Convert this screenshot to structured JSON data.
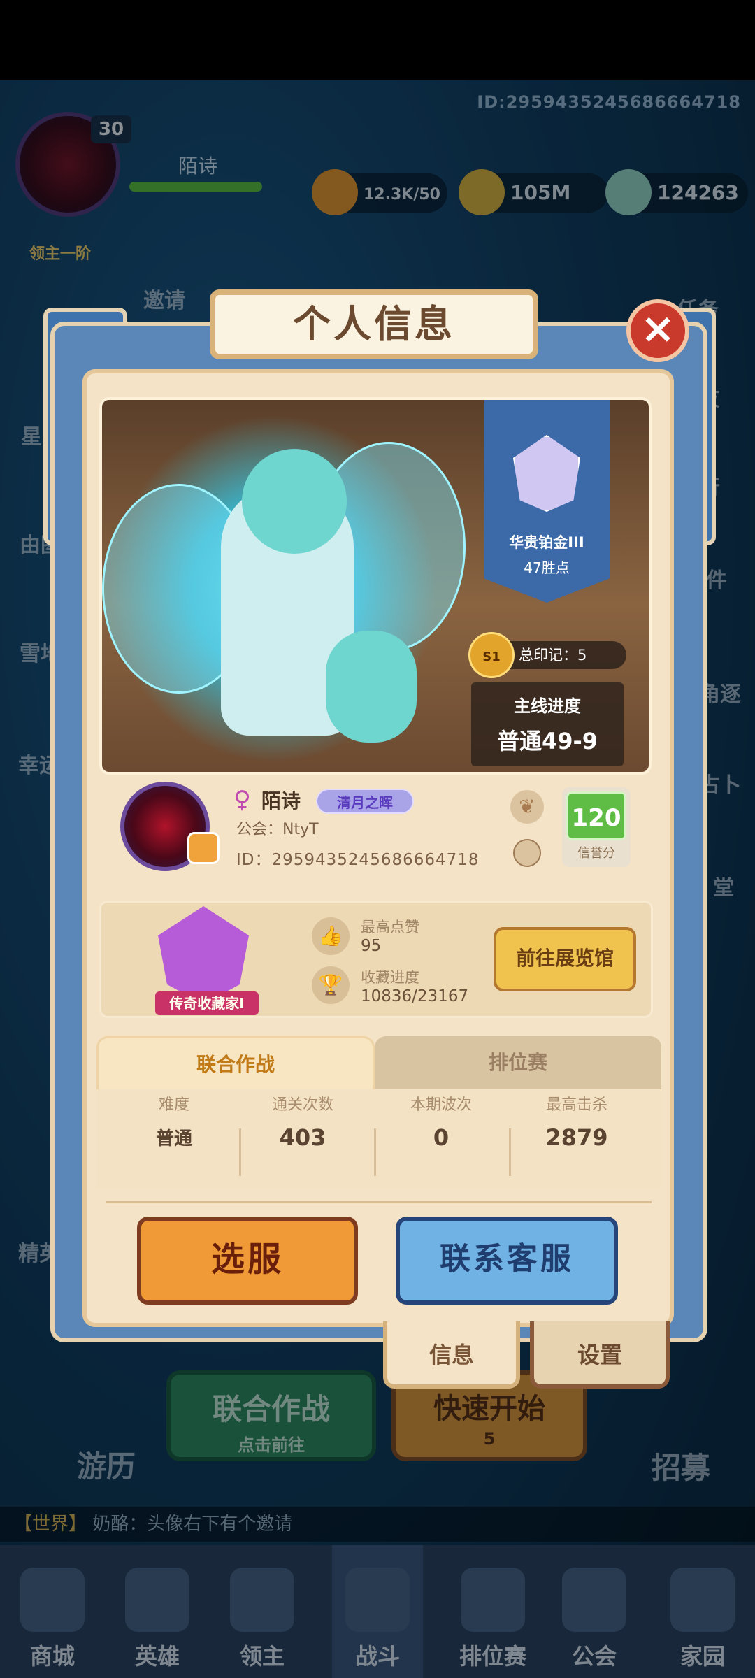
{
  "hud": {
    "player_id_top": "ID:2959435245686664718",
    "level": "30",
    "rank_label": "领主一阶",
    "player_name": "陌诗",
    "resources": {
      "energy": "12.3K/50",
      "gold": "105M",
      "gems": "124263"
    }
  },
  "side_menu": {
    "left": [
      "邀请",
      "星",
      "由图",
      "雪地",
      "幸运"
    ],
    "right": [
      "任务",
      "友",
      "行",
      "邮件",
      "角逐",
      "占卜",
      "堂"
    ]
  },
  "dialog": {
    "title": "个人信息",
    "close": "×",
    "hero": {
      "rank_name": "华贵铂金III",
      "rank_points": "47胜点",
      "season_badge": "S1",
      "total_marks": "总印记：5",
      "progress_title": "主线进度",
      "progress_value": "普通49-9"
    },
    "profile": {
      "name": "陌诗",
      "gender_icon": "♀",
      "title_badge": "清月之晖",
      "guild": "公会：NtyT",
      "id": "ID：2959435245686664718",
      "credit_value": "120",
      "credit_label": "信誉分"
    },
    "collection": {
      "badge_label": "传奇收藏家I",
      "likes_label": "最高点赞",
      "likes_value": "95",
      "progress_label": "收藏进度",
      "progress_value": "10836/23167",
      "gallery_button": "前往展览馆"
    },
    "tabs": [
      "联合作战",
      "排位赛"
    ],
    "table": {
      "headers": [
        "难度",
        "通关次数",
        "本期波次",
        "最高击杀"
      ],
      "row": [
        "普通",
        "403",
        "0",
        "2879"
      ]
    },
    "buttons": {
      "select_server": "选服",
      "contact_support": "联系客服"
    },
    "subtabs": [
      "信息",
      "设置"
    ]
  },
  "behind": {
    "coop_title": "联合作战",
    "coop_sub": "点击前往",
    "quick_start": "快速开始",
    "quick_cost": "5",
    "travel": "游历",
    "recruit": "招募",
    "elite": "精英"
  },
  "chat": {
    "channel": "【世界】",
    "sender": "奶酪",
    "message": "：头像右下有个邀请"
  },
  "nav": [
    "商城",
    "英雄",
    "领主",
    "战斗",
    "排位赛",
    "公会",
    "家园"
  ]
}
